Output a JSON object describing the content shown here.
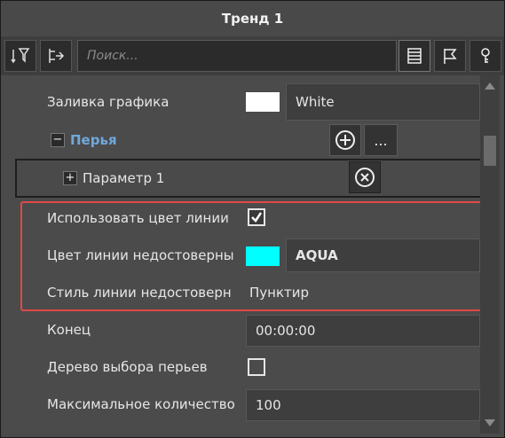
{
  "window": {
    "title": "Тренд 1"
  },
  "toolbar": {
    "search_placeholder": "Поиск...",
    "icons": [
      "sort-filter-icon",
      "collapse-tree-icon",
      "list-view-icon",
      "flag-icon",
      "key-icon"
    ]
  },
  "properties": {
    "chart_fill": {
      "label": "Заливка графика",
      "color_name": "White",
      "color": "#ffffff"
    },
    "pens_group": {
      "label": "Перья",
      "add_icon": "plus-circle-icon",
      "more_label": "..."
    },
    "param1": {
      "label": "Параметр 1",
      "remove_icon": "close-circle-icon"
    },
    "use_line_color": {
      "label": "Использовать цвет линии",
      "checked": true
    },
    "unreliable_color": {
      "label": "Цвет линии недостоверны",
      "color_name": "AQUA",
      "color": "#00ffff"
    },
    "unreliable_style": {
      "label": "Стиль линии недостоверн",
      "value": "Пунктир"
    },
    "end": {
      "label": "Конец",
      "value": "00:00:00"
    },
    "pen_tree": {
      "label": "Дерево выбора перьев",
      "checked": false
    },
    "max_count": {
      "label": "Максимальное количество",
      "value": "100"
    }
  },
  "colors": {
    "highlight": "#e04848",
    "group_label": "#6fa8dc"
  }
}
